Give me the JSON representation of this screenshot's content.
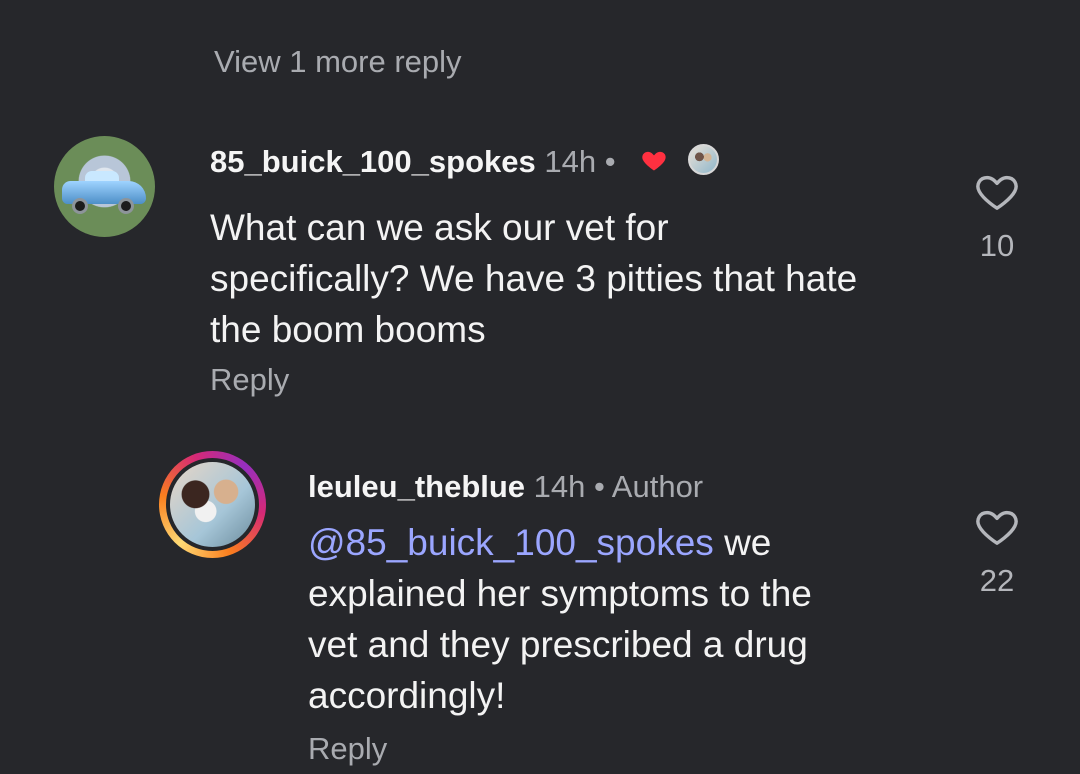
{
  "view_more": "View 1 more reply",
  "comments": [
    {
      "username": "85_buick_100_spokes",
      "time": "14h",
      "separator": "•",
      "text": "What can we ask our vet for specifically?  We have 3 pitties that hate the boom booms",
      "reply_label": "Reply",
      "likes": "10",
      "liked_by_author": true
    },
    {
      "username": "leuleu_theblue",
      "time": "14h",
      "separator": "•",
      "author_tag": "Author",
      "mention": "@85_buick_100_spokes",
      "text": " we explained her symptoms to the vet and they prescribed a drug accordingly!",
      "reply_label": "Reply",
      "likes": "22"
    }
  ],
  "icons": {
    "heart_outline": "heart-icon",
    "heart_filled": "heart-filled-icon",
    "avatar": "avatar"
  },
  "colors": {
    "background": "#26272b",
    "primary_text": "#f3f3f3",
    "secondary_text": "#a9abb0",
    "mention": "#9ba6ff",
    "heart_red": "#ff3040"
  }
}
